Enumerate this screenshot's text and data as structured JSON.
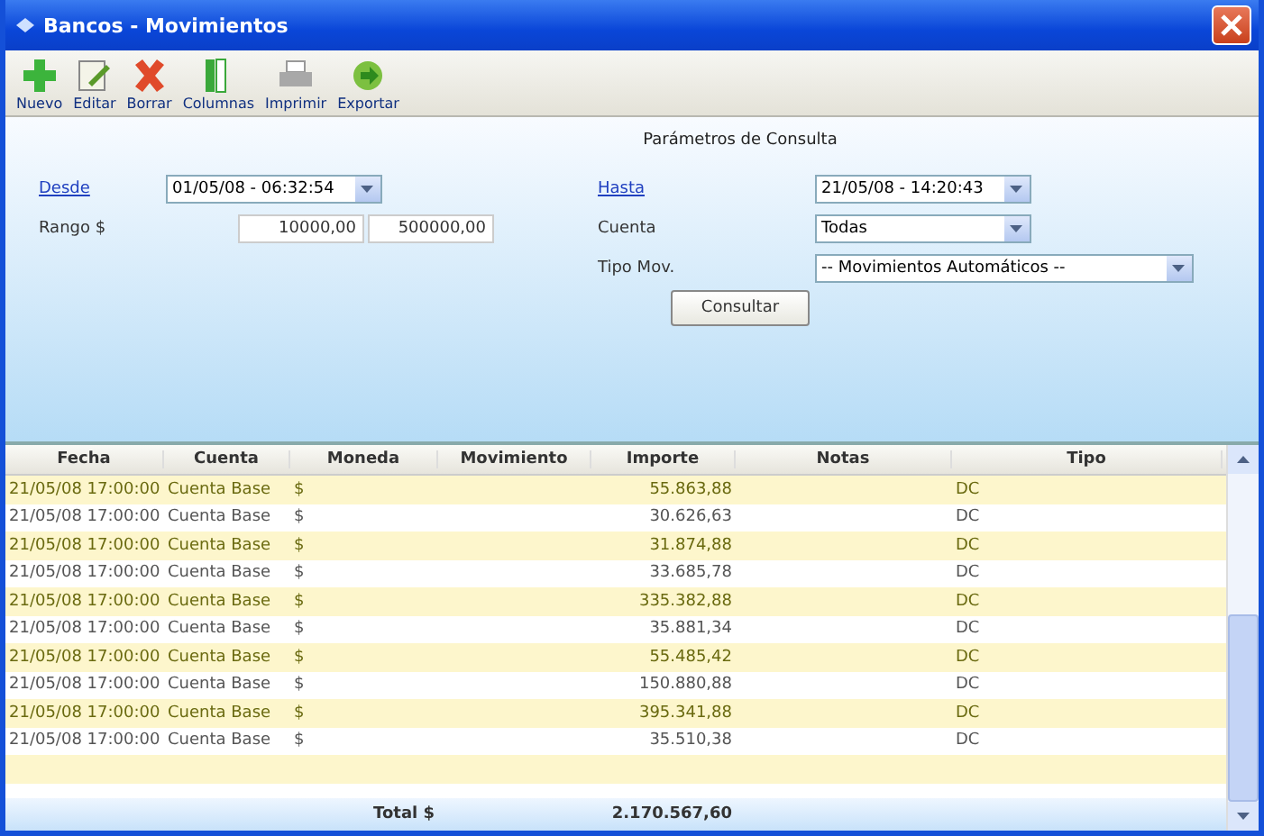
{
  "window": {
    "title": "Bancos - Movimientos"
  },
  "toolbar": [
    {
      "label": "Nuevo",
      "kind": "new"
    },
    {
      "label": "Editar",
      "kind": "edit"
    },
    {
      "label": "Borrar",
      "kind": "delete"
    },
    {
      "label": "Columnas",
      "kind": "columns"
    },
    {
      "label": "Imprimir",
      "kind": "print"
    },
    {
      "label": "Exportar",
      "kind": "export"
    }
  ],
  "params": {
    "title": "Parámetros de Consulta",
    "desde": {
      "label": "Desde",
      "value": "01/05/08 - 06:32:54"
    },
    "hasta": {
      "label": "Hasta",
      "value": "21/05/08 - 14:20:43"
    },
    "rango": {
      "label": "Rango $",
      "min": "10000,00",
      "max": "500000,00"
    },
    "cuenta": {
      "label": "Cuenta",
      "value": "Todas"
    },
    "tipo_mov": {
      "label": "Tipo Mov.",
      "value": "-- Movimientos Automáticos --"
    },
    "button": "Consultar"
  },
  "table": {
    "columns": [
      "Fecha",
      "Cuenta",
      "Moneda",
      "Movimiento",
      "Importe",
      "Notas",
      "Tipo"
    ],
    "rows": [
      [
        "21/05/08 17:00:00",
        "Cuenta Base",
        "$",
        "",
        "55.863,88",
        "",
        "DC"
      ],
      [
        "21/05/08 17:00:00",
        "Cuenta Base",
        "$",
        "",
        "30.626,63",
        "",
        "DC"
      ],
      [
        "21/05/08 17:00:00",
        "Cuenta Base",
        "$",
        "",
        "31.874,88",
        "",
        "DC"
      ],
      [
        "21/05/08 17:00:00",
        "Cuenta Base",
        "$",
        "",
        "33.685,78",
        "",
        "DC"
      ],
      [
        "21/05/08 17:00:00",
        "Cuenta Base",
        "$",
        "",
        "335.382,88",
        "",
        "DC"
      ],
      [
        "21/05/08 17:00:00",
        "Cuenta Base",
        "$",
        "",
        "35.881,34",
        "",
        "DC"
      ],
      [
        "21/05/08 17:00:00",
        "Cuenta Base",
        "$",
        "",
        "55.485,42",
        "",
        "DC"
      ],
      [
        "21/05/08 17:00:00",
        "Cuenta Base",
        "$",
        "",
        "150.880,88",
        "",
        "DC"
      ],
      [
        "21/05/08 17:00:00",
        "Cuenta Base",
        "$",
        "",
        "395.341,88",
        "",
        "DC"
      ],
      [
        "21/05/08 17:00:00",
        "Cuenta Base",
        "$",
        "",
        "35.510,38",
        "",
        "DC"
      ]
    ],
    "total_label": "Total $",
    "total": "2.170.567,60"
  }
}
